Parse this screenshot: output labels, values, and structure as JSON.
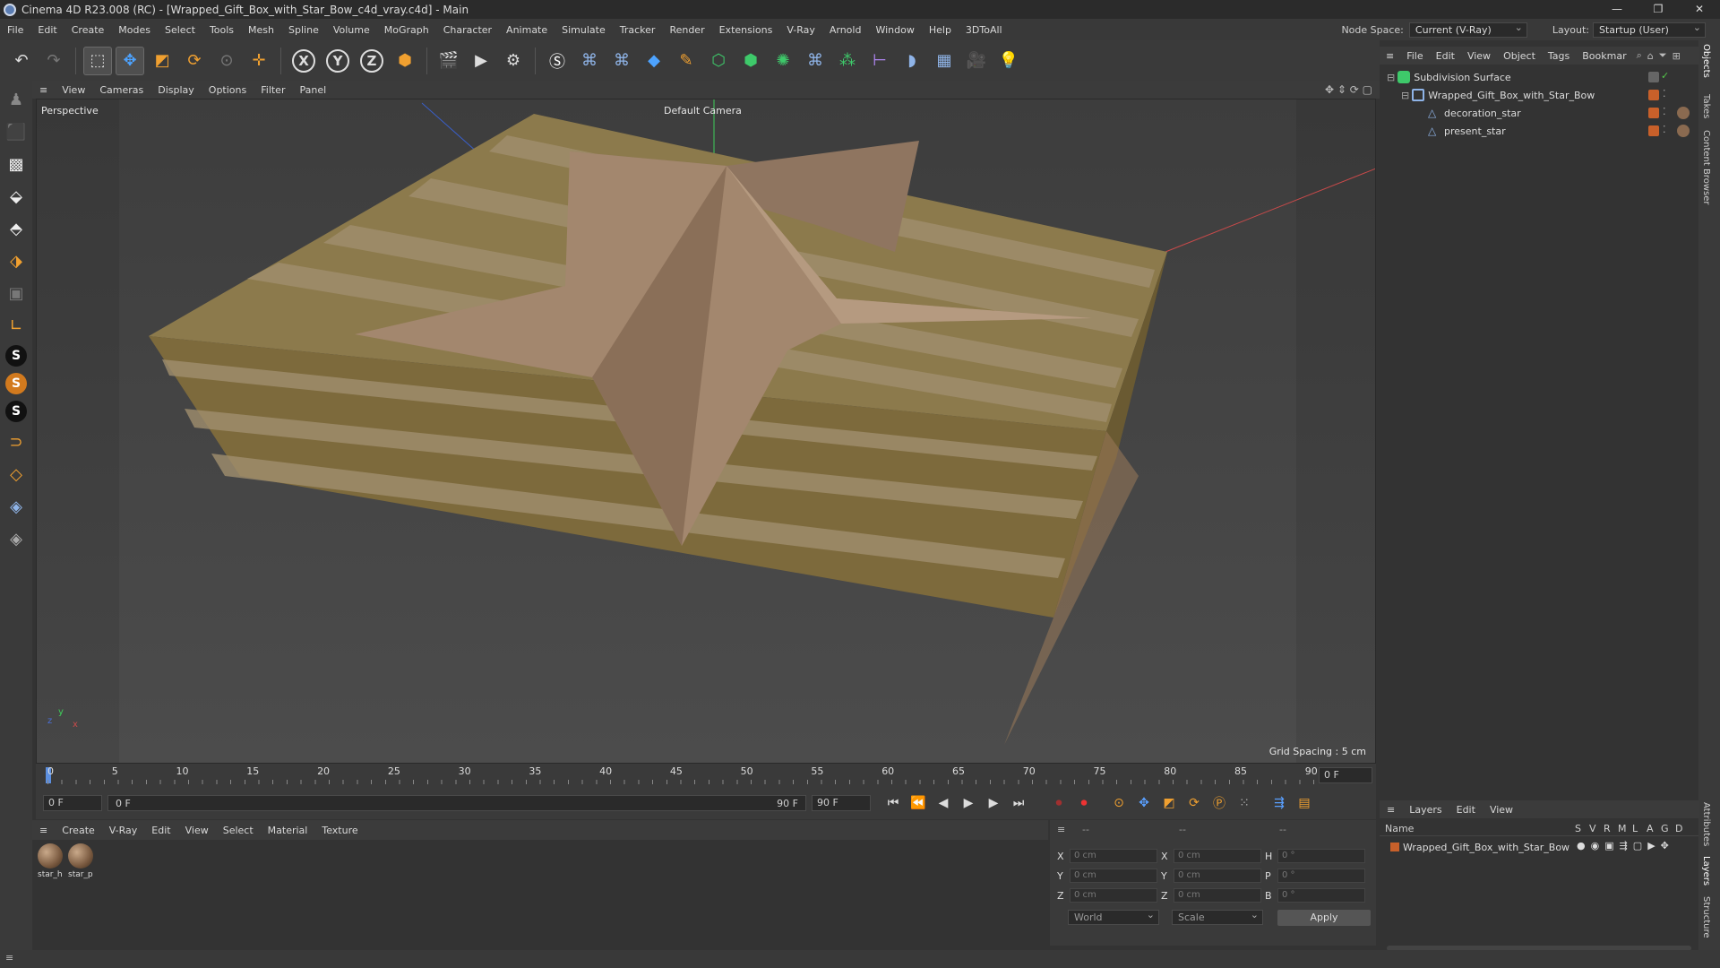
{
  "window": {
    "title": "Cinema 4D R23.008 (RC) - [Wrapped_Gift_Box_with_Star_Bow_c4d_vray.c4d] - Main",
    "controls": [
      "—",
      "❐",
      "✕"
    ]
  },
  "menubar": {
    "items": [
      "File",
      "Edit",
      "Create",
      "Modes",
      "Select",
      "Tools",
      "Mesh",
      "Spline",
      "Volume",
      "MoGraph",
      "Character",
      "Animate",
      "Simulate",
      "Tracker",
      "Render",
      "Extensions",
      "V-Ray",
      "Arnold",
      "Window",
      "Help",
      "3DToAll"
    ],
    "node_space_label": "Node Space:",
    "node_space_value": "Current (V-Ray)",
    "layout_label": "Layout:",
    "layout_value": "Startup (User)"
  },
  "toolbar": {
    "axis_x": "X",
    "axis_y": "Y",
    "axis_z": "Z"
  },
  "viewport": {
    "menu": [
      "View",
      "Cameras",
      "Display",
      "Options",
      "Filter",
      "Panel"
    ],
    "label": "Perspective",
    "camera": "Default Camera",
    "grid_spacing": "Grid Spacing : 5 cm",
    "axis_y": "y",
    "axis_x": "x",
    "axis_z": "z"
  },
  "timeline": {
    "ticks": [
      "0",
      "5",
      "10",
      "15",
      "20",
      "25",
      "30",
      "35",
      "40",
      "45",
      "50",
      "55",
      "60",
      "65",
      "70",
      "75",
      "80",
      "85",
      "90"
    ],
    "current_frame": "0 F",
    "start_field": "0 F",
    "range_start": "0 F",
    "range_end": "90 F",
    "end_field": "90 F"
  },
  "material_manager": {
    "menu": [
      "Create",
      "V-Ray",
      "Edit",
      "View",
      "Select",
      "Material",
      "Texture"
    ],
    "materials": [
      {
        "name": "star_h"
      },
      {
        "name": "star_p"
      }
    ]
  },
  "coordinates": {
    "header": [
      "--",
      "--",
      "--"
    ],
    "rows": [
      {
        "a1": "X",
        "v1": "0 cm",
        "a2": "X",
        "v2": "0 cm",
        "a3": "H",
        "v3": "0 °"
      },
      {
        "a1": "Y",
        "v1": "0 cm",
        "a2": "Y",
        "v2": "0 cm",
        "a3": "P",
        "v3": "0 °"
      },
      {
        "a1": "Z",
        "v1": "0 cm",
        "a2": "Z",
        "v2": "0 cm",
        "a3": "B",
        "v3": "0 °"
      }
    ],
    "space": "World",
    "mode": "Scale",
    "apply": "Apply"
  },
  "object_manager": {
    "menu": [
      "File",
      "Edit",
      "View",
      "Object",
      "Tags",
      "Bookmar"
    ],
    "objects": [
      {
        "name": "Subdivision Surface"
      },
      {
        "name": "Wrapped_Gift_Box_with_Star_Bow"
      },
      {
        "name": "decoration_star"
      },
      {
        "name": "present_star"
      }
    ]
  },
  "layers": {
    "menu": [
      "Layers",
      "Edit",
      "View"
    ],
    "header_name": "Name",
    "header_cols": [
      "S",
      "V",
      "R",
      "M",
      "L",
      "A",
      "G",
      "D"
    ],
    "rows": [
      {
        "name": "Wrapped_Gift_Box_with_Star_Bow"
      }
    ]
  },
  "side_tabs": [
    "Objects",
    "Takes",
    "Content Browser",
    "Attributes",
    "Layers",
    "Structure"
  ],
  "colors": {
    "accent_orange": "#d27a1e",
    "layer_color": "#c8602a",
    "green_check": "#53c84a"
  }
}
